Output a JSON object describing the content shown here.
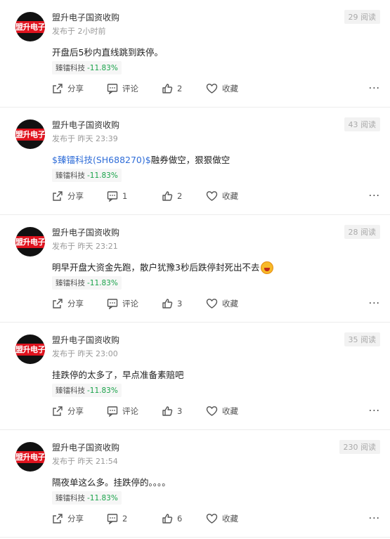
{
  "posts": [
    {
      "author": "盟升电子国资收购",
      "avatar_text": "盟升电子",
      "time": "发布于 2小时前",
      "views": "29 阅读",
      "content_prefix": "",
      "stock_text": "",
      "content": "开盘后5秒内直线跳到跌停。",
      "has_emoji": false,
      "tag_name": "臻镭科技",
      "tag_change": "-11.83%",
      "share_label": "分享",
      "comment_label": "评论",
      "like_count": "2",
      "fav_label": "收藏"
    },
    {
      "author": "盟升电子国资收购",
      "avatar_text": "盟升电子",
      "time": "发布于 昨天 23:39",
      "views": "43 阅读",
      "stock_text": "$臻镭科技(SH688270)$",
      "content": "融券做空，狠狠做空",
      "has_emoji": false,
      "tag_name": "臻镭科技",
      "tag_change": "-11.83%",
      "share_label": "分享",
      "comment_label": "1",
      "like_count": "2",
      "fav_label": "收藏"
    },
    {
      "author": "盟升电子国资收购",
      "avatar_text": "盟升电子",
      "time": "发布于 昨天 23:21",
      "views": "28 阅读",
      "stock_text": "",
      "content": "明早开盘大资金先跑，散户犹豫3秒后跌停封死出不去",
      "has_emoji": true,
      "tag_name": "臻镭科技",
      "tag_change": "-11.83%",
      "share_label": "分享",
      "comment_label": "评论",
      "like_count": "3",
      "fav_label": "收藏"
    },
    {
      "author": "盟升电子国资收购",
      "avatar_text": "盟升电子",
      "time": "发布于 昨天 23:00",
      "views": "35 阅读",
      "stock_text": "",
      "content": "挂跌停的太多了，早点准备素赔吧",
      "has_emoji": false,
      "tag_name": "臻镭科技",
      "tag_change": "-11.83%",
      "share_label": "分享",
      "comment_label": "评论",
      "like_count": "3",
      "fav_label": "收藏"
    },
    {
      "author": "盟升电子国资收购",
      "avatar_text": "盟升电子",
      "time": "发布于 昨天 21:54",
      "views": "230 阅读",
      "stock_text": "",
      "content": "隔夜单这么多。挂跌停的。。。。",
      "has_emoji": false,
      "tag_name": "臻镭科技",
      "tag_change": "-11.83%",
      "share_label": "分享",
      "comment_label": "2",
      "like_count": "6",
      "fav_label": "收藏"
    }
  ],
  "colors": {
    "stock_link": "#2f6dd8",
    "change_negative": "#1aa34a",
    "avatar_band": "#e0131e"
  },
  "icons": [
    "share-icon",
    "comment-icon",
    "like-icon",
    "favorite-icon",
    "more-icon"
  ]
}
